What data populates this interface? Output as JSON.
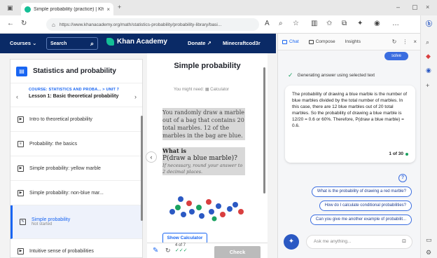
{
  "browser": {
    "tab_title": "Simple probability (practice) | Kh",
    "tab_close": "×",
    "new_tab": "+",
    "window_min": "–",
    "window_max": "▢",
    "window_close": "×",
    "url": "https://www.khanacademy.org/math/statistics-probability/probability-library/basi..."
  },
  "ka_header": {
    "courses": "Courses",
    "courses_caret": "⌄",
    "search": "Search",
    "logo_text": "Khan Academy",
    "donate": "Donate",
    "donate_ico": "↗",
    "user": "Minecraftcod3r"
  },
  "sidebar": {
    "title": "Statistics and probability",
    "course_label": "COURSE: STATISTICS AND PROBA... > UNIT 7",
    "lesson": "Lesson 1: Basic theoretical probability",
    "items": [
      {
        "label": "Intro to theoretical probability",
        "sub": "",
        "icon": "▶"
      },
      {
        "label": "Probability: the basics",
        "sub": "",
        "icon": "≡"
      },
      {
        "label": "Simple probability: yellow marble",
        "sub": "",
        "icon": "▶"
      },
      {
        "label": "Simple probability: non-blue mar...",
        "sub": "",
        "icon": "▶"
      },
      {
        "label": "Simple probability",
        "sub": "Not started",
        "icon": "✎"
      },
      {
        "label": "Intuitive sense of probabilities",
        "sub": "",
        "icon": "▶"
      }
    ]
  },
  "exercise": {
    "title": "Simple probability",
    "calc_note": "You might need: ▦ Calculator",
    "question": "You randomly draw a marble out of a bag that contains 20 total marbles. 12 of the marbles in the bag are blue.",
    "q_what": "What is",
    "q_expr": "P(draw a blue marble)?",
    "q_hint": "If necessary, round your answer to 2 decimal places.",
    "show_calculator": "Show Calculator",
    "progress": "4 of 7",
    "check": "Check",
    "marble_colors": [
      "#2b59c3",
      "#d93f3f",
      "#1aa260"
    ]
  },
  "copilot": {
    "tabs": [
      "Chat",
      "Compose",
      "Insights"
    ],
    "solve": "solve",
    "status": "Generating answer using selected text",
    "answer": "The probability of drawing a blue marble is the number of blue marbles divided by the total number of marbles. In this case, there are 12 blue marbles out of 20 total marbles. So the probability of drawing a blue marble is 12/20 = 0.6 or 60%. Therefore, P(draw a blue marble) = 0.6.",
    "count": "1 of 30",
    "suggestions": [
      "What is the probability of drawing a red marble?",
      "How do I calculate conditional probabilities?",
      "Can you give me another example of probabilit..."
    ],
    "input_placeholder": "Ask me anything..."
  },
  "colors": {
    "ka_navy": "#0a2a66",
    "ka_blue": "#1865f2",
    "ka_green": "#14bf96",
    "copilot_blue": "#3a6de0"
  }
}
